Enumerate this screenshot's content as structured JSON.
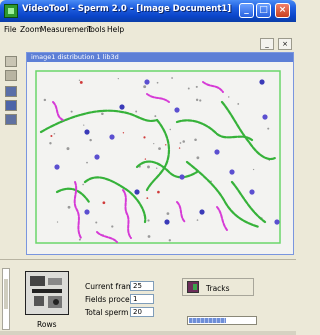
{
  "window": {
    "title": "VideoTool - Sperm 2.0 - [Image Document1]"
  },
  "menu": {
    "items": [
      "File",
      "Zoom",
      "Measurement",
      "Tools",
      "Help"
    ]
  },
  "document": {
    "tab_title": "image1 distribution 1 lib3d"
  },
  "panel": {
    "thumbnail_label": "Rows",
    "current_frame_label": "Current frame:",
    "current_frame_value": "25",
    "fields_processed_label": "Fields processed:",
    "fields_processed_value": "1",
    "total_sperm_label": "Total sperm count:",
    "total_sperm_value": "20",
    "tracks_label": "Tracks",
    "progress_fraction": 0.55
  },
  "colors": {
    "titlebar": "#0a44c8",
    "track_green": "#36b23a",
    "track_magenta": "#d63ad6",
    "roi_border": "#6bd66b"
  }
}
